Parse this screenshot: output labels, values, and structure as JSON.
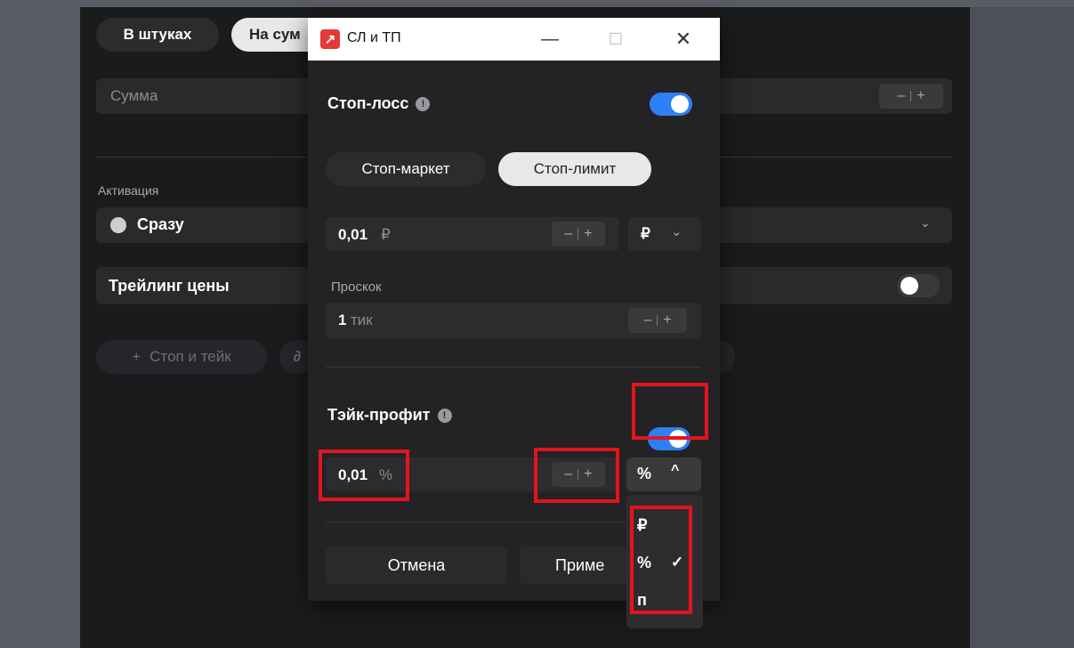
{
  "background_app": {
    "qty_tabs": [
      "В штуках",
      "На сумму"
    ],
    "qty_tab_visible": "На сум",
    "sum_placeholder": "Сумма",
    "activation_label": "Активация",
    "activation_value": "Сразу",
    "trailing_label": "Трейлинг цены",
    "stop_take_button": "Стоп и тейк",
    "stepper_minus": "–",
    "stepper_plus": "+"
  },
  "dialog": {
    "title": "СЛ и ТП",
    "window_buttons": {
      "minimize": "—",
      "maximize": "☐",
      "close": "✕"
    },
    "stop_loss": {
      "title": "Стоп-лосс",
      "enabled": true,
      "tabs": [
        "Стоп-маркет",
        "Стоп-лимит"
      ],
      "active_tab": "Стоп-лимит",
      "price_value": "0,01",
      "price_unit": "₽",
      "unit_select": "₽",
      "slippage_label": "Проскок",
      "slippage_value": "1",
      "slippage_unit": "тик"
    },
    "take_profit": {
      "title": "Тэйк-профит",
      "enabled": true,
      "value": "0,01",
      "value_unit": "%",
      "unit_select": "%",
      "unit_options": [
        {
          "label": "₽",
          "selected": false
        },
        {
          "label": "%",
          "selected": true
        },
        {
          "label": "п",
          "selected": false
        }
      ]
    },
    "buttons": {
      "cancel": "Отмена",
      "apply_visible": "Приме"
    }
  },
  "colors": {
    "accent": "#2f7ff5",
    "highlight": "#e3151c",
    "brand": "#e53935"
  }
}
